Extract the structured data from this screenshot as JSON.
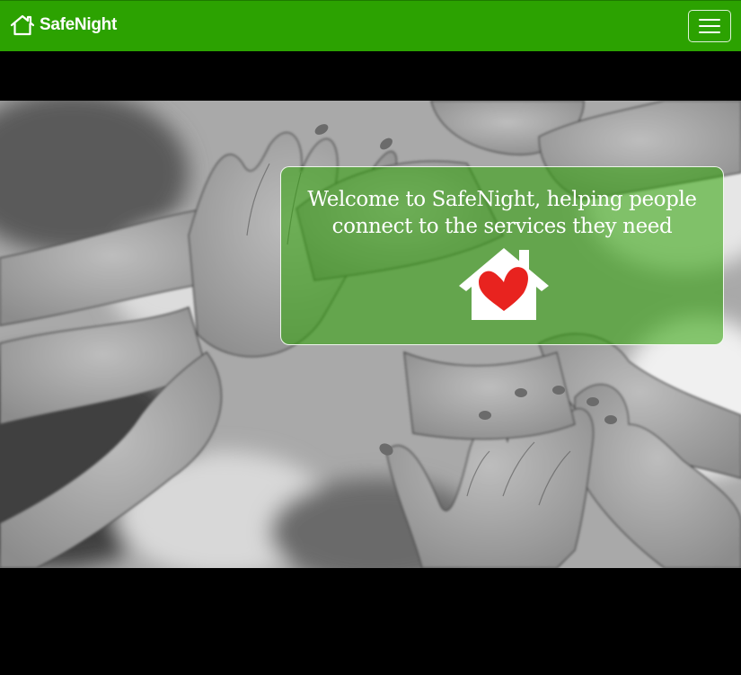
{
  "navbar": {
    "brand_name": "SafeNight",
    "brand_icon": "house-icon",
    "menu_icon": "hamburger-menu-icon",
    "background_color": "#2ca201"
  },
  "hero": {
    "background_image": "grayscale photo of many raised open hands",
    "welcome_text": "Welcome to SafeNight, helping people connect to the services they need",
    "logo_icon": "house-heart-icon",
    "card_color": "#2ca201",
    "heart_color": "#e8231f"
  }
}
